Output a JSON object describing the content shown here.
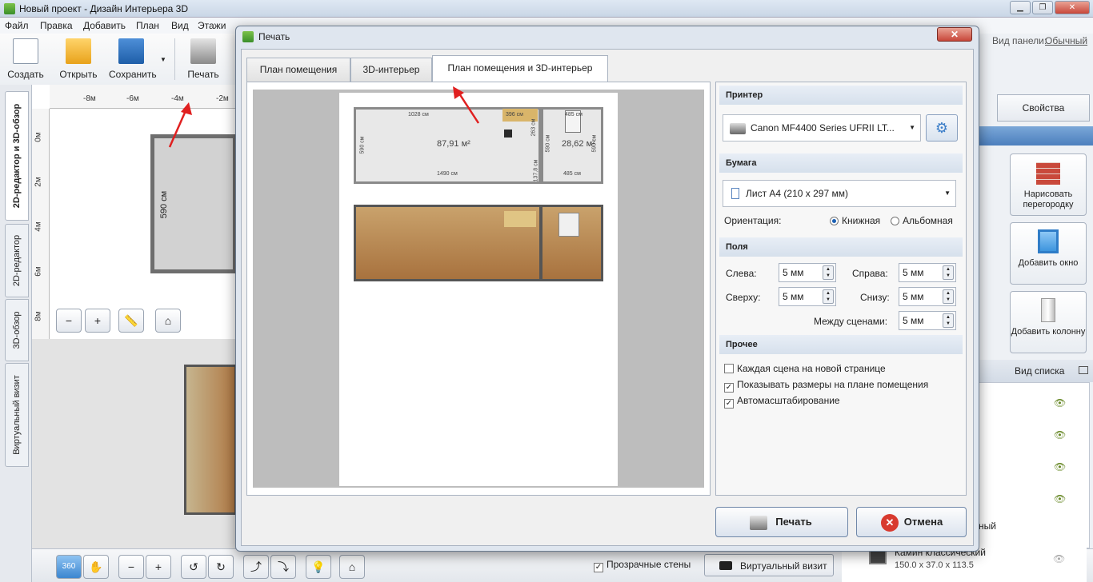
{
  "app": {
    "title": "Новый проект - Дизайн Интерьера 3D",
    "menu": [
      "Файл",
      "Правка",
      "Добавить",
      "План",
      "Вид",
      "Этажи"
    ],
    "toolbar": {
      "create": "Создать",
      "open": "Открыть",
      "save": "Сохранить",
      "print": "Печать"
    },
    "panel_view_label": "Вид панели:",
    "panel_view_value": "Обычный",
    "left_tabs": [
      "2D-редактор и 3D-обзор",
      "2D-редактор",
      "3D-обзор",
      "Виртуальный визит"
    ],
    "ruler_x": [
      "-8м",
      "-6м",
      "-4м",
      "-2м"
    ],
    "ruler_y": [
      "0м",
      "2м",
      "4м",
      "6м",
      "8м"
    ],
    "plan_dimension": "590 см",
    "transparent_walls": "Прозрачные стены",
    "virtual_visit_button": "Виртуальный визит",
    "right_panel": {
      "tab_properties": "Свойства",
      "cards": [
        "Нарисовать перегородку",
        "Добавить окно",
        "Добавить колонну"
      ],
      "list_view": "Вид списка",
      "item_name": "Камин классический",
      "item_size": "150.0 x 37.0 x 113.5",
      "partial_text": "ный"
    }
  },
  "dialog": {
    "title": "Печать",
    "tabs": [
      "План помещения",
      "3D-интерьер",
      "План помещения и 3D-интерьер"
    ],
    "preview": {
      "dim_top_left": "1028 см",
      "dim_sofa": "396 см",
      "dim_top_right": "485 см",
      "dim_bottom_left": "1490 см",
      "dim_bottom_right": "485 см",
      "dim_side_left": "590 см",
      "dim_side_mid": "590 см",
      "dim_side_right": "590 см",
      "dim_door": "137,8 см",
      "dim_small": "263 см",
      "area_left": "87,91 м²",
      "area_right": "28,62 м²"
    },
    "printer_section": "Принтер",
    "printer_value": "Canon MF4400 Series UFRII LT...",
    "paper_section": "Бумага",
    "paper_value": "Лист A4 (210 x 297 мм)",
    "orientation_label": "Ориентация:",
    "orientation_portrait": "Книжная",
    "orientation_landscape": "Альбомная",
    "margins_section": "Поля",
    "margin_left_label": "Слева:",
    "margin_left": "5 мм",
    "margin_right_label": "Справа:",
    "margin_right": "5 мм",
    "margin_top_label": "Сверху:",
    "margin_top": "5 мм",
    "margin_bottom_label": "Снизу:",
    "margin_bottom": "5 мм",
    "between_label": "Между сценами:",
    "between": "5 мм",
    "other_section": "Прочее",
    "opt_each_scene": "Каждая сцена на новой странице",
    "opt_show_dims": "Показывать размеры на плане помещения",
    "opt_autoscale": "Автомасштабирование",
    "print_button": "Печать",
    "cancel_button": "Отмена"
  },
  "colors": {
    "accent": "#1a5fb4",
    "wall": "#9a9a9a",
    "floor": "#b07a46",
    "arrow": "#e02020"
  }
}
